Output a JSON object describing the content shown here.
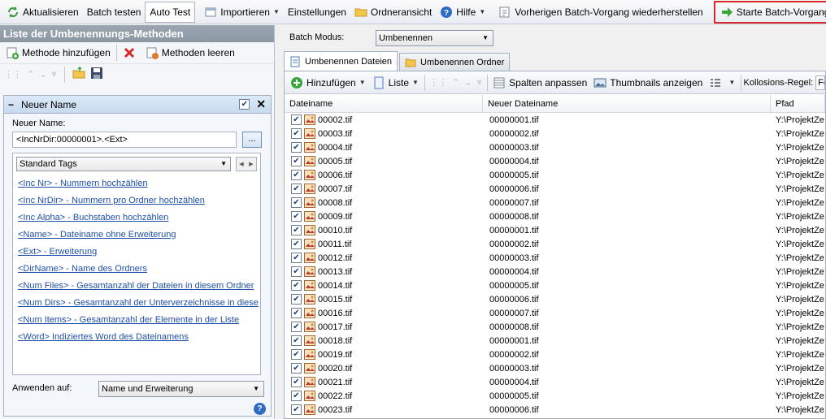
{
  "toolbar": {
    "refresh": "Aktualisieren",
    "batch_test": "Batch testen",
    "auto_test": "Auto Test",
    "import": "Importieren",
    "settings": "Einstellungen",
    "folder_view": "Ordneransicht",
    "help": "Hilfe",
    "restore": "Vorherigen Batch-Vorgang wiederherstellen",
    "start": "Starte Batch-Vorgang"
  },
  "left_panel": {
    "title": "Liste der Umbenennungs-Methoden",
    "add_method": "Methode hinzufügen",
    "clear_methods": "Methoden leeren",
    "section_title": "Neuer Name",
    "new_name_label": "Neuer Name:",
    "new_name_value": "<IncNrDir:00000001>.<Ext>",
    "dots_button": "...",
    "tags_combo": "Standard Tags",
    "tags": [
      "<Inc Nr> - Nummern hochzählen",
      "<Inc NrDir> - Nummern pro Ordner hochzählen",
      "<Inc Alpha> - Buchstaben hochzählen",
      "<Name> - Dateiname ohne Erweiterung",
      "<Ext> - Erweiterung",
      "<DirName> - Name des Ordners",
      "<Num Files> - Gesamtanzahl der Dateien in diesem Ordner",
      "<Num Dirs> - Gesamtanzahl der Unterverzeichnisse in diesem Ordner",
      "<Num Items> - Gesamtanzahl der Elemente in der Liste",
      "<Word> Indiziertes Word des Dateinamens"
    ],
    "apply_label": "Anwenden auf:",
    "apply_value": "Name und Erweiterung",
    "help_glyph": "?"
  },
  "right_panel": {
    "mode_label": "Batch Modus:",
    "mode_value": "Umbenennen",
    "tabs": [
      "Umbenennen Dateien",
      "Umbenennen Ordner"
    ],
    "list_tools": {
      "add": "Hinzufügen",
      "list": "Liste",
      "fit_columns": "Spalten anpassen",
      "thumbnails": "Thumbnails anzeigen",
      "collision_label": "Kollosions-Regel:",
      "collision_value": "Fehl"
    },
    "columns": [
      "Dateiname",
      "Neuer Dateiname",
      "Pfad"
    ],
    "rows": [
      [
        "00002.tif",
        "00000001.tif",
        "Y:\\ProjektZe"
      ],
      [
        "00003.tif",
        "00000002.tif",
        "Y:\\ProjektZe"
      ],
      [
        "00004.tif",
        "00000003.tif",
        "Y:\\ProjektZe"
      ],
      [
        "00005.tif",
        "00000004.tif",
        "Y:\\ProjektZe"
      ],
      [
        "00006.tif",
        "00000005.tif",
        "Y:\\ProjektZe"
      ],
      [
        "00007.tif",
        "00000006.tif",
        "Y:\\ProjektZe"
      ],
      [
        "00008.tif",
        "00000007.tif",
        "Y:\\ProjektZe"
      ],
      [
        "00009.tif",
        "00000008.tif",
        "Y:\\ProjektZe"
      ],
      [
        "00010.tif",
        "00000001.tif",
        "Y:\\ProjektZe"
      ],
      [
        "00011.tif",
        "00000002.tif",
        "Y:\\ProjektZe"
      ],
      [
        "00012.tif",
        "00000003.tif",
        "Y:\\ProjektZe"
      ],
      [
        "00013.tif",
        "00000004.tif",
        "Y:\\ProjektZe"
      ],
      [
        "00014.tif",
        "00000005.tif",
        "Y:\\ProjektZe"
      ],
      [
        "00015.tif",
        "00000006.tif",
        "Y:\\ProjektZe"
      ],
      [
        "00016.tif",
        "00000007.tif",
        "Y:\\ProjektZe"
      ],
      [
        "00017.tif",
        "00000008.tif",
        "Y:\\ProjektZe"
      ],
      [
        "00018.tif",
        "00000001.tif",
        "Y:\\ProjektZe"
      ],
      [
        "00019.tif",
        "00000002.tif",
        "Y:\\ProjektZe"
      ],
      [
        "00020.tif",
        "00000003.tif",
        "Y:\\ProjektZe"
      ],
      [
        "00021.tif",
        "00000004.tif",
        "Y:\\ProjektZe"
      ],
      [
        "00022.tif",
        "00000005.tif",
        "Y:\\ProjektZe"
      ],
      [
        "00023.tif",
        "00000006.tif",
        "Y:\\ProjektZe"
      ]
    ]
  },
  "colors": {
    "highlight_border": "#d52a2a",
    "panel_title_bg": "#8c97a4",
    "link": "#1f4fa8"
  }
}
